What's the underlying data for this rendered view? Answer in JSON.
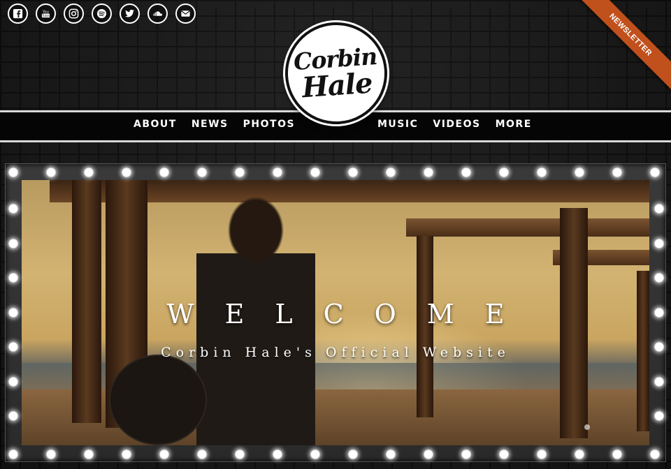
{
  "social": {
    "items": [
      {
        "name": "facebook-icon",
        "label": "f"
      },
      {
        "name": "youtube-icon",
        "label": "You Tube"
      },
      {
        "name": "instagram-icon",
        "label": ""
      },
      {
        "name": "spotify-icon",
        "label": ""
      },
      {
        "name": "twitter-icon",
        "label": ""
      },
      {
        "name": "soundcloud-icon",
        "label": ""
      },
      {
        "name": "email-icon",
        "label": ""
      }
    ]
  },
  "newsletter": {
    "label": "NEWSLETTER",
    "color": "#c0501c"
  },
  "logo": {
    "line1": "Corbin",
    "line2": "Hale"
  },
  "nav": {
    "left": [
      "ABOUT",
      "NEWS",
      "PHOTOS"
    ],
    "right": [
      "MUSIC",
      "VIDEOS",
      "MORE"
    ]
  },
  "hero": {
    "title": "WELCOME",
    "subtitle": "Corbin Hale's Official Website"
  }
}
